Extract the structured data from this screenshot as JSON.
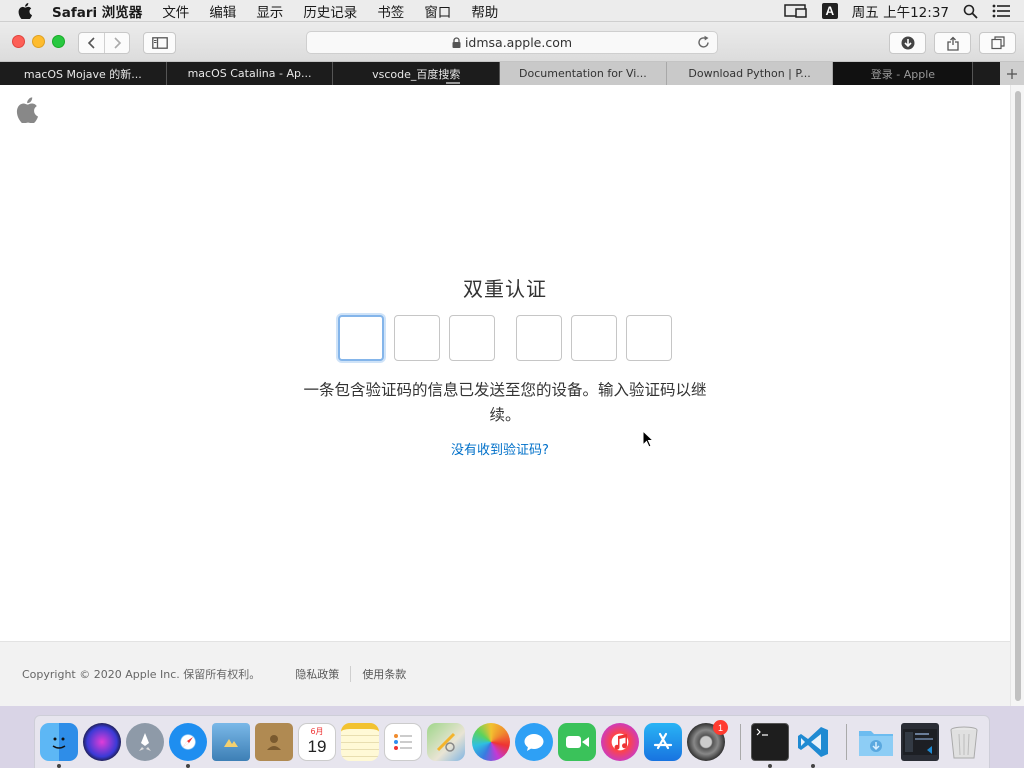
{
  "menubar": {
    "app_name": "Safari 浏览器",
    "items": [
      "文件",
      "编辑",
      "显示",
      "历史记录",
      "书签",
      "窗口",
      "帮助"
    ],
    "input_method": "A",
    "clock": "周五 上午12:37"
  },
  "toolbar": {
    "url": "idmsa.apple.com"
  },
  "tabs": [
    {
      "label": "macOS Mojave 的新..."
    },
    {
      "label": "macOS Catalina - Ap..."
    },
    {
      "label": "vscode_百度搜索"
    },
    {
      "label": "Documentation for Vi..."
    },
    {
      "label": "Download Python | P..."
    },
    {
      "label": "登录 - Apple"
    }
  ],
  "page": {
    "heading": "双重认证",
    "message": "一条包含验证码的信息已发送至您的设备。输入验证码以继续。",
    "resend_link": "没有收到验证码?",
    "code_digits": [
      "",
      "",
      "",
      "",
      "",
      ""
    ]
  },
  "footer": {
    "copyright": "Copyright © 2020 Apple Inc. 保留所有权利。",
    "privacy": "隐私政策",
    "terms": "使用条款"
  },
  "dock": {
    "apps": [
      "finder",
      "siri",
      "launchpad",
      "safari",
      "preview",
      "contacts",
      "calendar",
      "notes",
      "reminders",
      "maps",
      "photos",
      "messages",
      "facetime",
      "itunes",
      "app-store",
      "system-preferences",
      "terminal",
      "vscode",
      "downloads",
      "screenshot",
      "trash"
    ],
    "calendar_month": "6月",
    "calendar_day": "19",
    "sysprefs_badge": "1"
  },
  "colors": {
    "link": "#0070c9",
    "focus": "#84b5ea"
  }
}
